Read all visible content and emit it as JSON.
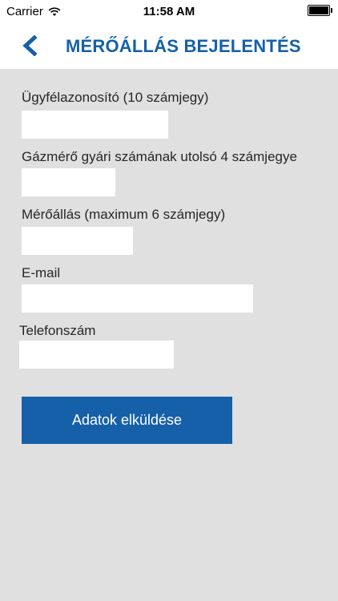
{
  "status_bar": {
    "carrier": "Carrier",
    "time": "11:58 AM",
    "battery_level": 1.0
  },
  "navbar": {
    "back_icon": "chevron-left-icon",
    "title": "MÉRŐÁLLÁS BEJELENTÉS"
  },
  "colors": {
    "brand_blue": "#1560a9",
    "accent_red": "#d9362c",
    "accent_green": "#3d9a5b",
    "background_gray": "#e0e0e0"
  },
  "form": {
    "customer_id": {
      "label": "Ügyfélazonosító (10 számjegy)",
      "value": "",
      "placeholder": ""
    },
    "meter_serial": {
      "label": "Gázmérő gyári számának utolsó 4 számjegye",
      "value": "",
      "placeholder": ""
    },
    "meter_reading": {
      "label": "Mérőállás (maximum 6 számjegy)",
      "value": "",
      "placeholder": ""
    },
    "email": {
      "label": "E-mail",
      "value": "",
      "placeholder": ""
    },
    "phone": {
      "label": "Telefonszám",
      "value": "",
      "placeholder": ""
    },
    "submit_label": "Adatok elküldése"
  }
}
